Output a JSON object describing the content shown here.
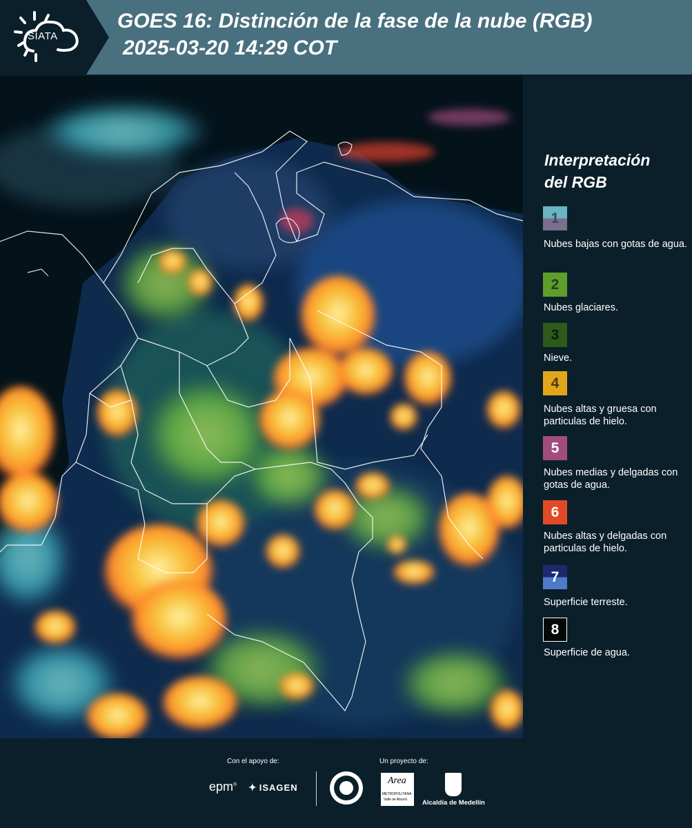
{
  "header": {
    "logo_text": "SIATA",
    "title_line1": "GOES 16: Distinción de la fase de la nube (RGB)",
    "title_line2": "2025-03-20 14:29 COT"
  },
  "legend": {
    "title_line1": "Interpretación",
    "title_line2": "del RGB",
    "items": [
      {
        "num": "1",
        "label": "Nubes bajas con gotas de agua.",
        "color_top": "#6ab4c4",
        "color_bottom": "#7a6f8e",
        "text_color": "#3a4a55"
      },
      {
        "num": "2",
        "label": "Nubes glaciares.",
        "color_top": "#5e9e2c",
        "color_bottom": "#5e9e2c",
        "text_color": "#2c3a20"
      },
      {
        "num": "3",
        "label": "Nieve.",
        "color_top": "#2e5a1c",
        "color_bottom": "#2e5a1c",
        "text_color": "#0e1a0a"
      },
      {
        "num": "4",
        "label": "Nubes altas y gruesa con particulas de hielo.",
        "color_top": "#e3a61b",
        "color_bottom": "#e3a61b",
        "text_color": "#4a3a1a"
      },
      {
        "num": "5",
        "label": "Nubes medias y delgadas con gotas de agua.",
        "color_top": "#a24c7e",
        "color_bottom": "#a24c7e",
        "text_color": "#ffffff"
      },
      {
        "num": "6",
        "label": "Nubes altas y delgadas con particulas de hielo.",
        "color_top": "#e14a26",
        "color_bottom": "#e14a26",
        "text_color": "#ffffff"
      },
      {
        "num": "7",
        "label": "Superficie terreste.",
        "color_top": "#1a2a6e",
        "color_bottom": "#4f79c9",
        "text_color": "#ffffff"
      },
      {
        "num": "8",
        "label": "Superficie de agua.",
        "color_top": "#020a06",
        "color_bottom": "#020a06",
        "text_color": "#ffffff"
      }
    ]
  },
  "footer": {
    "support_label": "Con el apoyo de:",
    "project_label": "Un proyecto de:",
    "epm": "epm",
    "isagen": "ISAGEN",
    "area_line1": "Area",
    "area_line2": "METROPOLITANA",
    "area_line3": "Valle de Aburrá",
    "alcaldia": "Alcaldía de Medellín"
  },
  "colors": {
    "background": "#0b1f2b",
    "header_band": "#49707e",
    "cloud_yellow": "#f7c03a",
    "cloud_orange": "#ff8a2a",
    "cloud_red": "#e0402a",
    "cloud_green": "#7ed04a",
    "cloud_cyan": "#4fc8d6",
    "land_blue": "#1a3c7a"
  }
}
